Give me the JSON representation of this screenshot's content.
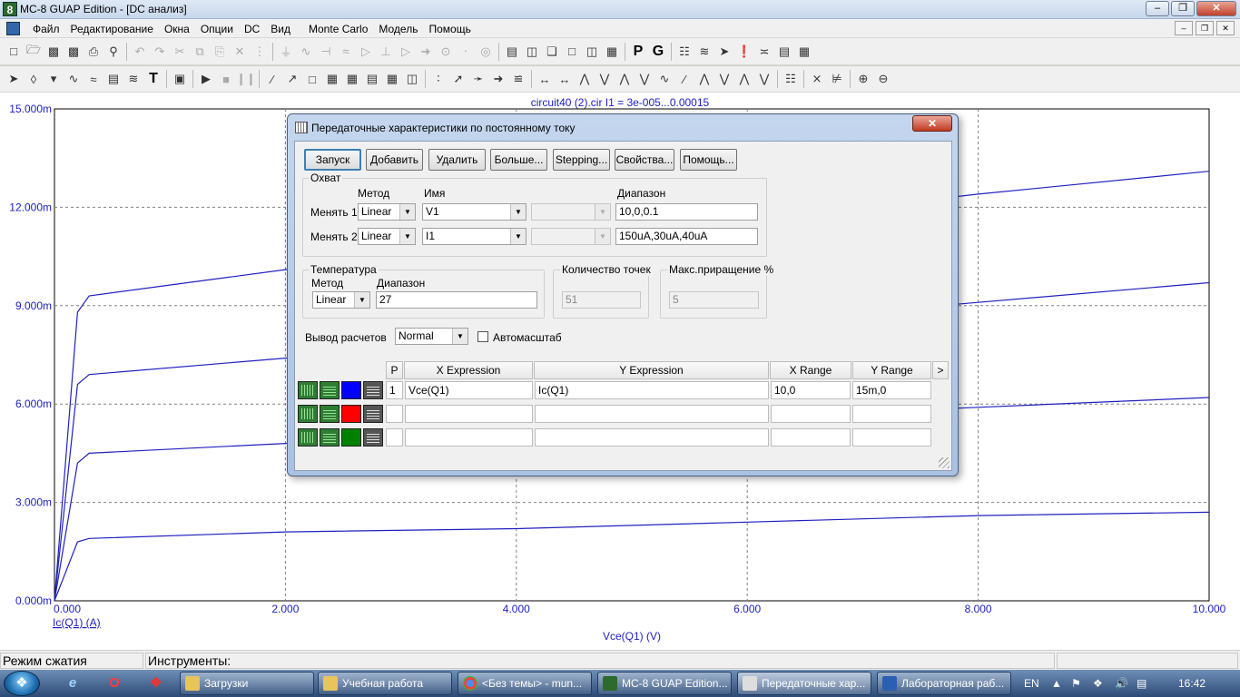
{
  "window": {
    "app_icon": "8",
    "title": "MC-8 GUAP Edition - [DC анализ]",
    "controls": [
      "–",
      "❐",
      "✕"
    ]
  },
  "menubar": {
    "items": [
      "Файл",
      "Редактирование",
      "Окна",
      "Опции",
      "DC",
      "Вид",
      "Monte Carlo",
      "Модель",
      "Помощь"
    ],
    "mdi_controls": [
      "–",
      "❐",
      "✕"
    ]
  },
  "toolbar1": {
    "icons": [
      "new-icon",
      "open-icon",
      "save-icon",
      "save-as-icon",
      "print-icon",
      "print-preview-icon",
      "undo-icon",
      "redo-icon",
      "cut-icon",
      "copy-icon",
      "paste-icon",
      "delete-icon",
      "select-all-icon",
      "ground-icon",
      "resistor-icon",
      "capacitor-icon",
      "inductor-icon",
      "diode-icon",
      "battery-icon",
      "opamp-icon",
      "switch-icon",
      "transistor-icon",
      "node-icon",
      "source-icon",
      "window-tile-h-icon",
      "window-tile-v-icon",
      "cascade-icon",
      "window-icon",
      "split-icon",
      "calculator-icon",
      "p-text-icon",
      "g-text-icon",
      "table-icon",
      "waveform-icon",
      "probe-icon",
      "marker-icon",
      "scope-icon",
      "cursor-value-icon",
      "plot-props-icon"
    ],
    "bold_labels": {
      "p": "P",
      "g": "G"
    }
  },
  "toolbar2": {
    "text_tool": "T"
  },
  "plot": {
    "header": "circuit40 (2).cir I1 = 3e-005...0.00015",
    "y_ticks": [
      "15.000m",
      "12.000m",
      "9.000m",
      "6.000m",
      "3.000m",
      "0.000m"
    ],
    "x_ticks": [
      "0.000",
      "2.000",
      "4.000",
      "6.000",
      "8.000",
      "10.000"
    ],
    "ylabel": "Ic(Q1) (A)",
    "xlabel": "Vce(Q1) (V)",
    "trace_color": "#2020c0",
    "grid_color": "#808080"
  },
  "chart_data": {
    "type": "line",
    "title": "circuit40 (2).cir I1 = 3e-005...0.00015",
    "xlabel": "Vce(Q1) (V)",
    "ylabel": "Ic(Q1) (A)",
    "xlim": [
      0,
      10
    ],
    "ylim": [
      0,
      0.015
    ],
    "grid": true,
    "series": [
      {
        "x": [
          0,
          0.2,
          0.3,
          2,
          4,
          6,
          8,
          10
        ],
        "y": [
          0,
          0.0018,
          0.0019,
          0.0021,
          0.0022,
          0.0024,
          0.0026,
          0.0027
        ]
      },
      {
        "x": [
          0,
          0.2,
          0.3,
          2,
          4,
          6,
          8,
          10
        ],
        "y": [
          0,
          0.0042,
          0.0045,
          0.0048,
          0.0052,
          0.0056,
          0.0059,
          0.0062
        ]
      },
      {
        "x": [
          0,
          0.2,
          0.3,
          2,
          4,
          6,
          8,
          10
        ],
        "y": [
          0,
          0.0066,
          0.0069,
          0.0074,
          0.008,
          0.0085,
          0.0091,
          0.0097
        ]
      },
      {
        "x": [
          0,
          0.2,
          0.3,
          2,
          4,
          6,
          8,
          10
        ],
        "y": [
          0,
          0.0088,
          0.0093,
          0.0101,
          0.0109,
          0.0116,
          0.0124,
          0.0131
        ]
      }
    ]
  },
  "statusbar": {
    "mode": "Режим сжатия",
    "tools": "Инструменты:"
  },
  "dialog": {
    "title": "Передаточные характеристики по постоянному току",
    "buttons": [
      "Запуск",
      "Добавить",
      "Удалить",
      "Больше...",
      "Stepping...",
      "Свойства...",
      "Помощь..."
    ],
    "sweep": {
      "group_label": "Охват",
      "col_method": "Метод",
      "col_name": "Имя",
      "col_range": "Диапазон",
      "rows": [
        {
          "label": "Менять 1",
          "method": "Linear",
          "name": "V1",
          "range": "10,0,0.1"
        },
        {
          "label": "Менять 2",
          "method": "Linear",
          "name": "I1",
          "range": "150uA,30uA,40uA"
        }
      ]
    },
    "temperature": {
      "group_label": "Температура",
      "method_label": "Метод",
      "range_label": "Диапазон",
      "method": "Linear",
      "range": "27"
    },
    "points": {
      "label": "Количество точек",
      "value": "51"
    },
    "max_step": {
      "label": "Макс.приращение %",
      "value": "5"
    },
    "output": {
      "label": "Вывод  расчетов",
      "value": "Normal"
    },
    "autoscale": {
      "label": "Автомасштаб",
      "checked": false
    },
    "table": {
      "headers": [
        "P",
        "X Expression",
        "Y Expression",
        "X Range",
        "Y Range"
      ],
      "scroll_arrow": ">",
      "rows": [
        {
          "p": "1",
          "x_expr": "Vce(Q1)",
          "y_expr": "Ic(Q1)",
          "x_range": "10,0",
          "y_range": "15m,0",
          "color": "#0000ff"
        },
        {
          "p": "",
          "x_expr": "",
          "y_expr": "",
          "x_range": "",
          "y_range": "",
          "color": "#ff0000"
        },
        {
          "p": "",
          "x_expr": "",
          "y_expr": "",
          "x_range": "",
          "y_range": "",
          "color": "#008000"
        }
      ]
    }
  },
  "taskbar": {
    "tasks": [
      "Загрузки",
      "Учебная работа",
      "<Без темы> - mun...",
      "MC-8 GUAP Edition...",
      "Передаточные хар...",
      "Лабораторная раб..."
    ],
    "language": "EN",
    "clock": "16:42"
  }
}
